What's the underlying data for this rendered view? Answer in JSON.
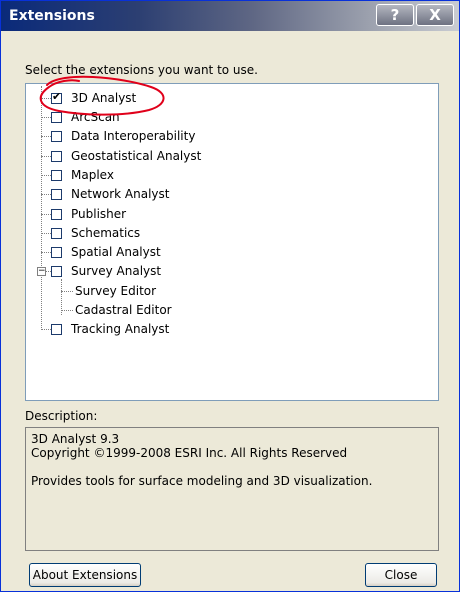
{
  "window": {
    "title": "Extensions",
    "help_button": "?",
    "close_button": "X"
  },
  "instructions": "Select the extensions you want to use.",
  "tree": {
    "items": [
      {
        "label": "3D Analyst",
        "checked": true
      },
      {
        "label": "ArcScan",
        "checked": false
      },
      {
        "label": "Data Interoperability",
        "checked": false
      },
      {
        "label": "Geostatistical Analyst",
        "checked": false
      },
      {
        "label": "Maplex",
        "checked": false
      },
      {
        "label": "Network Analyst",
        "checked": false
      },
      {
        "label": "Publisher",
        "checked": false
      },
      {
        "label": "Schematics",
        "checked": false
      },
      {
        "label": "Spatial Analyst",
        "checked": false
      },
      {
        "label": "Survey Analyst",
        "checked": false,
        "expanded": true,
        "children": [
          {
            "label": "Survey Editor"
          },
          {
            "label": "Cadastral Editor"
          }
        ]
      },
      {
        "label": "Tracking Analyst",
        "checked": false
      }
    ],
    "check_mark": "✔",
    "expander_symbol": "−"
  },
  "description": {
    "label": "Description:",
    "line1": "3D Analyst 9.3",
    "line2": "Copyright ©1999-2008 ESRI Inc. All Rights Reserved",
    "line3": "Provides tools for surface modeling and 3D visualization."
  },
  "buttons": {
    "about": "About Extensions",
    "close": "Close"
  },
  "colors": {
    "annotation": "#e0001a",
    "titlebar_start": "#0a2a7a",
    "dialog_bg": "#ece9d8"
  }
}
